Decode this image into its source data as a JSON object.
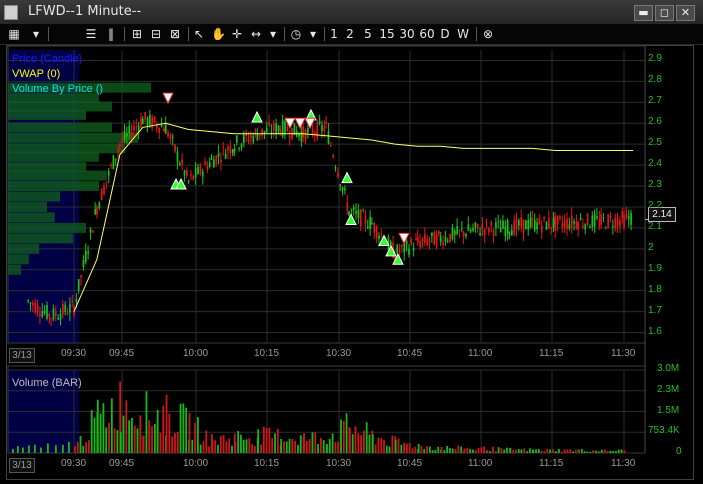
{
  "window": {
    "title": "LFWD--1 Minute--",
    "btn_min": "▬",
    "btn_max": "◻",
    "btn_close": "✕"
  },
  "toolbar": {
    "period_buttons": [
      "1",
      "2",
      "5",
      "15",
      "30",
      "60",
      "D",
      "W"
    ]
  },
  "price_panel": {
    "legend": [
      "Price (Candle)",
      "VWAP (0)",
      "Volume By Price ()"
    ],
    "legend_colors": [
      "#0000cc",
      "#ffff00",
      "#00e0e0"
    ],
    "y_ticks": [
      "2.9",
      "2.8",
      "2.7",
      "2.6",
      "2.5",
      "2.4",
      "2.3",
      "2.2",
      "2.1",
      "2",
      "1.9",
      "1.8",
      "1.7",
      "1.6"
    ],
    "last_price": "2.14",
    "date_label": "3/13",
    "x_ticks": [
      "09:30",
      "09:45",
      "10:00",
      "10:15",
      "10:30",
      "10:45",
      "11:00",
      "11:15",
      "11:30"
    ]
  },
  "volume_panel": {
    "legend": "Volume (BAR)",
    "y_ticks": [
      "3.0M",
      "2.3M",
      "1.5M",
      "753.4K",
      "0"
    ],
    "date_label": "3/13",
    "x_ticks": [
      "09:30",
      "09:45",
      "10:00",
      "10:15",
      "10:30",
      "10:45",
      "11:00",
      "11:15",
      "11:30"
    ]
  },
  "chart_data": {
    "type": "line",
    "title": "LFWD--1 Minute--",
    "xlabel": "",
    "ylabel": "",
    "x": [
      "09:20",
      "09:25",
      "09:30",
      "09:35",
      "09:40",
      "09:45",
      "09:50",
      "09:55",
      "10:00",
      "10:05",
      "10:10",
      "10:15",
      "10:20",
      "10:25",
      "10:30",
      "10:35",
      "10:40",
      "10:45",
      "10:50",
      "10:55",
      "11:00",
      "11:05",
      "11:10",
      "11:15",
      "11:20",
      "11:25",
      "11:30",
      "11:32"
    ],
    "series": [
      {
        "name": "Price (Candle)",
        "values": [
          1.75,
          1.68,
          1.72,
          2.2,
          2.5,
          2.62,
          2.58,
          2.32,
          2.42,
          2.5,
          2.55,
          2.58,
          2.55,
          2.58,
          2.18,
          2.12,
          1.98,
          2.03,
          2.05,
          2.08,
          2.1,
          2.1,
          2.12,
          2.12,
          2.13,
          2.13,
          2.14,
          2.15
        ]
      },
      {
        "name": "VWAP (0)",
        "values": [
          null,
          null,
          1.7,
          1.95,
          2.45,
          2.58,
          2.6,
          2.57,
          2.56,
          2.55,
          2.55,
          2.55,
          2.55,
          2.54,
          2.53,
          2.52,
          2.5,
          2.49,
          2.49,
          2.48,
          2.48,
          2.48,
          2.48,
          2.47,
          2.47,
          2.47,
          2.47,
          2.47
        ]
      }
    ],
    "volume": {
      "x": [
        "09:30",
        "09:35",
        "09:40",
        "09:45",
        "09:50",
        "09:55",
        "10:00",
        "10:05",
        "10:10",
        "10:15",
        "10:20",
        "10:25",
        "10:30",
        "10:35",
        "10:40",
        "10:45",
        "10:50",
        "10:55",
        "11:00",
        "11:05",
        "11:10",
        "11:15",
        "11:20",
        "11:25",
        "11:30"
      ],
      "values": [
        250000,
        1700000,
        2400000,
        1900000,
        1800000,
        1400000,
        600000,
        750000,
        800000,
        800000,
        700000,
        750000,
        1300000,
        800000,
        500000,
        350000,
        250000,
        220000,
        200000,
        160000,
        150000,
        140000,
        130000,
        110000,
        120000
      ]
    },
    "ylim": [
      1.55,
      2.95
    ],
    "volume_ylim": [
      0,
      3000000
    ],
    "grid": true,
    "legend": "top-left"
  }
}
